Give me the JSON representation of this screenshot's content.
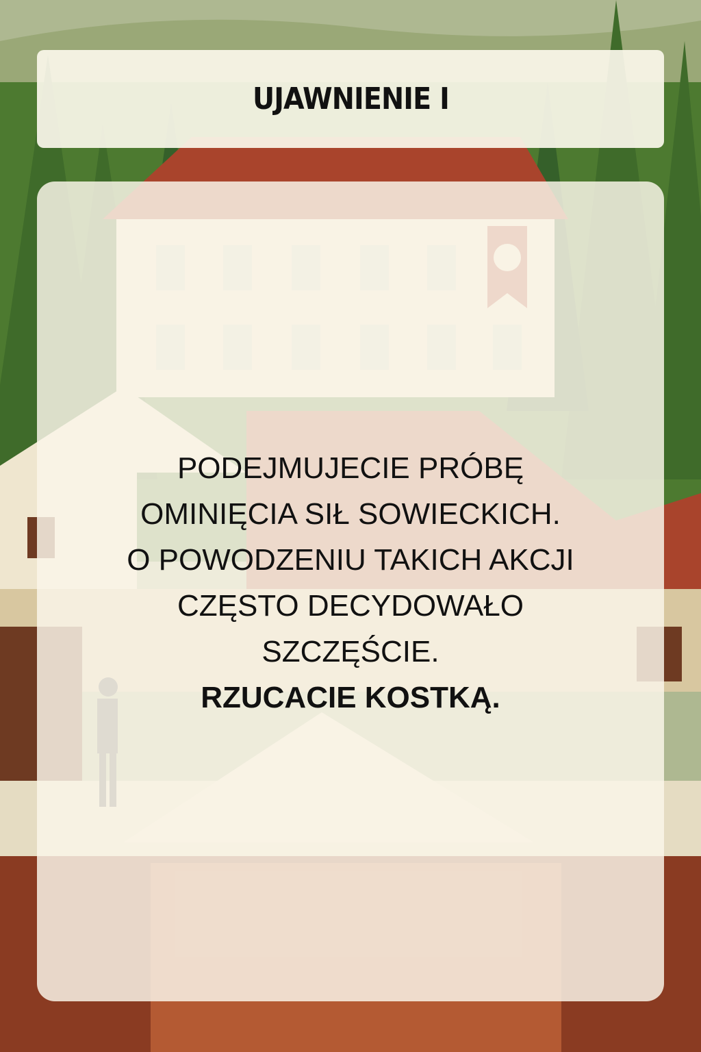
{
  "card": {
    "title": "UJAWNIENIE I",
    "lines": [
      "PODEJMUJECIE PRÓBĘ",
      "OMINIĘCIA SIŁ SOWIECKICH.",
      "O POWODZENIU TAKICH AKCJI",
      "CZĘSTO DECYDOWAŁO",
      "SZCZĘŚCIE."
    ],
    "instruction": "RZUCACIE KOSTKĄ."
  },
  "colors": {
    "sky": "#aeb891",
    "forest": "#3f6b2a",
    "roof": "#a9442c",
    "wall": "#efe6cf",
    "panel": "#faf6ea",
    "text": "#111111"
  }
}
